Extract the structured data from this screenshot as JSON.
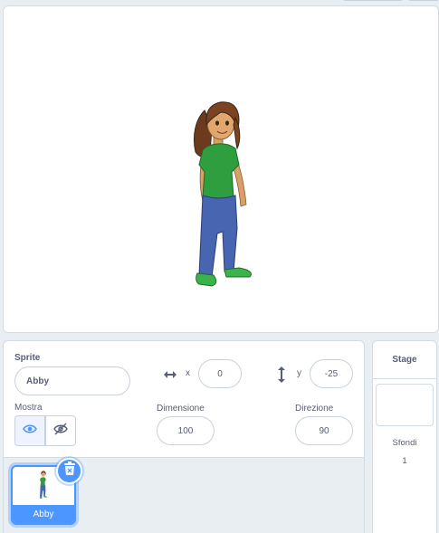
{
  "sprite_info": {
    "sprite_label": "Sprite",
    "sprite_name": "Abby",
    "x_label": "x",
    "x_value": "0",
    "y_label": "y",
    "y_value": "-25",
    "show_label": "Mostra",
    "size_label": "Dimensione",
    "size_value": "100",
    "direction_label": "Direzione",
    "direction_value": "90"
  },
  "sprite_list": {
    "items": [
      {
        "name": "Abby",
        "selected": true
      }
    ]
  },
  "stage_panel": {
    "title": "Stage",
    "backdrops_label": "Sfondi",
    "backdrops_count": "1"
  },
  "colors": {
    "accent": "#4c97ff",
    "text": "#575e75",
    "panel_bg": "#e9eef2"
  },
  "icons": [
    "eye-icon",
    "eye-hidden-icon",
    "horizontal-arrows-icon",
    "vertical-arrows-icon",
    "trash-icon"
  ]
}
